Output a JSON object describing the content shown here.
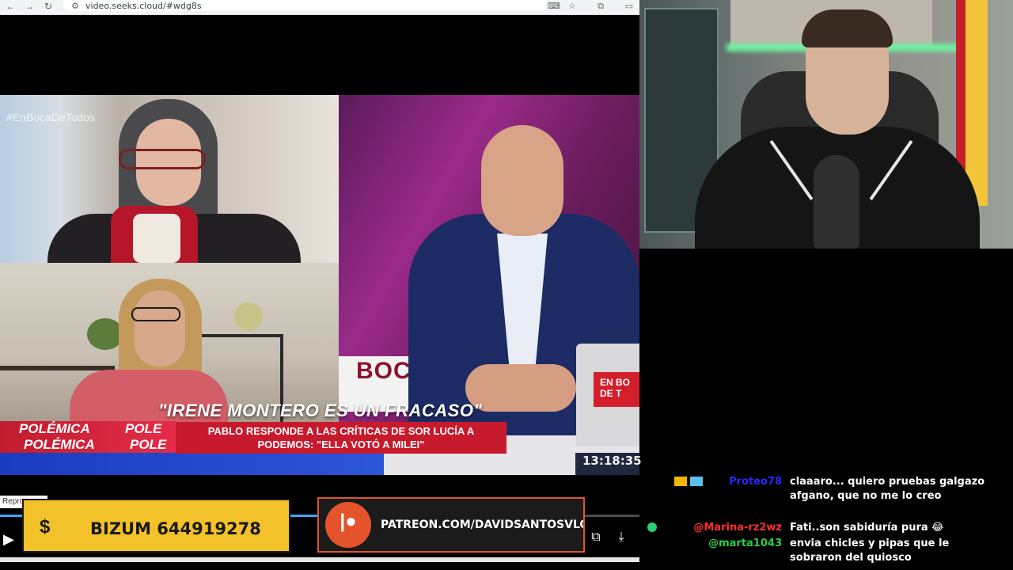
{
  "browser": {
    "url": "video.seeks.cloud/#wdg8s",
    "back_icon": "arrow-left-icon",
    "forward_icon": "arrow-right-icon",
    "reload_icon": "reload-icon"
  },
  "video": {
    "hashtag": "#EnBocaDeTodos",
    "headline": "\"IRENE MONTERO ES UN FRACASO\"",
    "subheadline_line1": "PABLO RESPONDE A LAS CRÍTICAS DE SOR LUCÍA A",
    "subheadline_line2": "PODEMOS: \"ELLA VOTÓ A MILEI\"",
    "polemica_1": "POLÉMICA",
    "polemica_2": "POLÉMICA",
    "pole_1": "POLE",
    "pole_2": "POLE",
    "studio_letters": "BOCA",
    "laptop_text_1": "EN BO",
    "laptop_text_2": "DE T",
    "clock": "13:18:35"
  },
  "player": {
    "tooltip": "Repro",
    "progress_fraction": 0.5
  },
  "bizum": {
    "icon": "$",
    "text": "BIZUM 644919278"
  },
  "patreon": {
    "text": "PATREON.COM/DAVIDSANTOSVLOG"
  },
  "chat": {
    "messages": [
      {
        "user": "Proteo78",
        "color": "#2a2aff",
        "text": "claaaro... quiero pruebas galgazo afgano, que no me lo creo"
      },
      {
        "user": "@Marina-rz2wz",
        "color": "#ff3030",
        "text": "Fati..son sabiduría pura 😂"
      },
      {
        "user": "@marta1043",
        "color": "#2ecc40",
        "text": "envia chicles y pipas que le sobraron del quiosco"
      }
    ]
  },
  "colors": {
    "accent_red": "#c71a2d",
    "bizum_yellow": "#f3c22a",
    "patreon_orange": "#e4532c"
  }
}
